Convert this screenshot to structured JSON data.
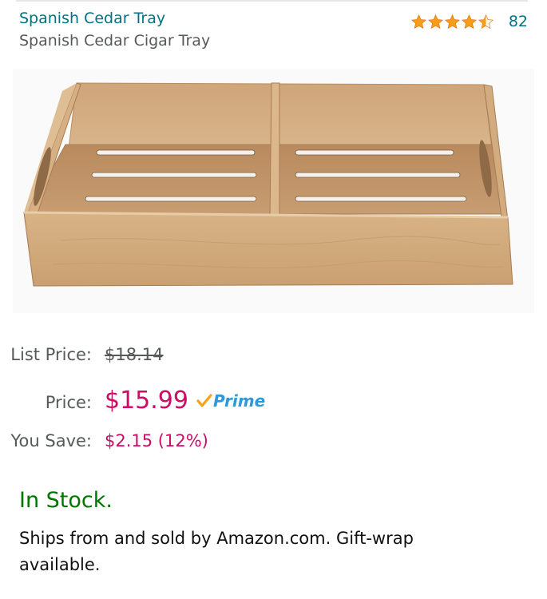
{
  "product": {
    "title": "Spanish Cedar Tray",
    "subtitle": "Spanish Cedar Cigar Tray",
    "rating": 4.5,
    "rating_count": "82",
    "star_color": "#f79c1b"
  },
  "pricing": {
    "list_price_label": "List Price:",
    "list_price_value": "$18.14",
    "price_label": "Price:",
    "price_value": "$15.99",
    "prime_label": "Prime",
    "save_label": "You Save:",
    "save_value": "$2.15 (12%)"
  },
  "availability": {
    "stock_text": "In Stock.",
    "ships_text": "Ships from and sold by Amazon.com. Gift-wrap available."
  },
  "colors": {
    "link": "#007185",
    "price": "#cc0c65",
    "in_stock": "#007600",
    "prime": "#2f99d8"
  }
}
